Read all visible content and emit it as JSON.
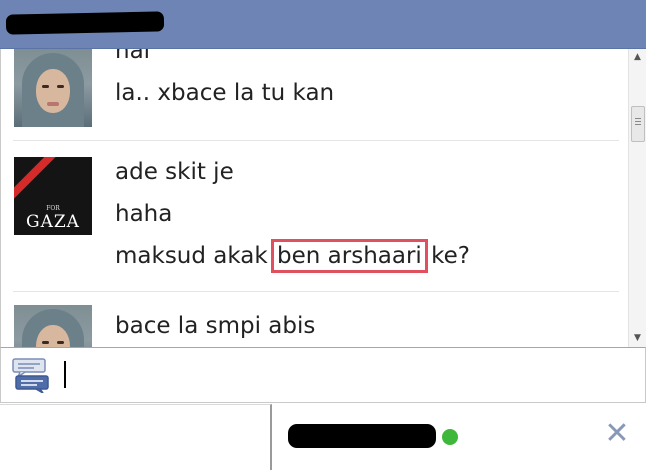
{
  "window": {
    "title": "",
    "title_redacted": true
  },
  "messages": [
    {
      "sender_avatar": "woman-hijab-avatar",
      "lines": [
        "hai",
        "la.. xbace la tu kan"
      ]
    },
    {
      "sender_avatar": "for-gaza-avatar",
      "avatar_text": {
        "small": "FOR",
        "large": "GAZA"
      },
      "lines": [
        "ade skit je",
        "haha"
      ],
      "highlight_line": {
        "before": "maksud akak ",
        "highlight": "ben arshaari",
        "after": " ke?"
      }
    },
    {
      "sender_avatar": "woman-hijab-avatar",
      "lines": [
        "bace la smpi abis"
      ]
    }
  ],
  "input": {
    "value": "",
    "placeholder": "",
    "icon": "chat-bubbles-icon"
  },
  "contact_tab": {
    "name": "",
    "name_redacted": true,
    "status": "online",
    "close_icon": "close-icon",
    "close_label": "✕"
  },
  "colors": {
    "titlebar": "#6d84b4",
    "online": "#3fb73a",
    "highlight_box": "#e0505e",
    "close": "#8a98b8"
  }
}
